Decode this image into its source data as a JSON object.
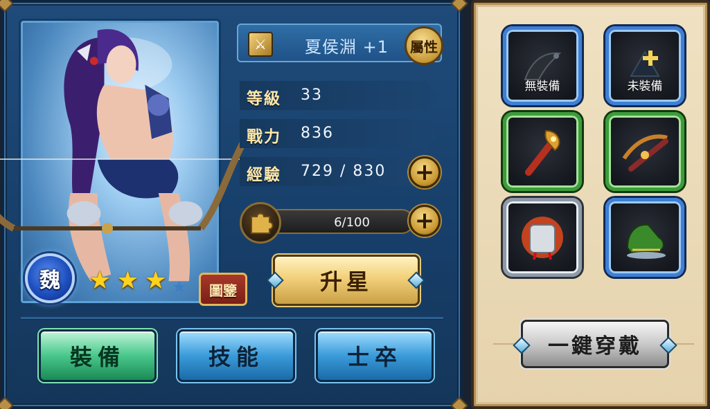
{
  "hero": {
    "name": "夏侯淵 +1",
    "kingdom": "魏",
    "stars": 3,
    "max_stars": 4
  },
  "buttons": {
    "attributes": "屬性",
    "codex": "圖鑒",
    "star_up": "升星",
    "equip_all": "一鍵穿戴"
  },
  "stats": {
    "level_label": "等級",
    "level_value": "33",
    "power_label": "戰力",
    "power_value": "836",
    "exp_label": "經驗",
    "exp_value": "729 / 830"
  },
  "shards": {
    "text": "6/100",
    "progress": 0.06
  },
  "tabs": [
    {
      "label": "裝備",
      "active": true
    },
    {
      "label": "技能",
      "active": false
    },
    {
      "label": "士卒",
      "active": false
    }
  ],
  "equipment": {
    "slot1_label": "無裝備",
    "slot2_label": "未裝備"
  },
  "colors": {
    "panel_blue": "#1f4b7a",
    "parchment": "#efe1c2",
    "gold": "#c9982f",
    "active_green": "#48c78b"
  }
}
